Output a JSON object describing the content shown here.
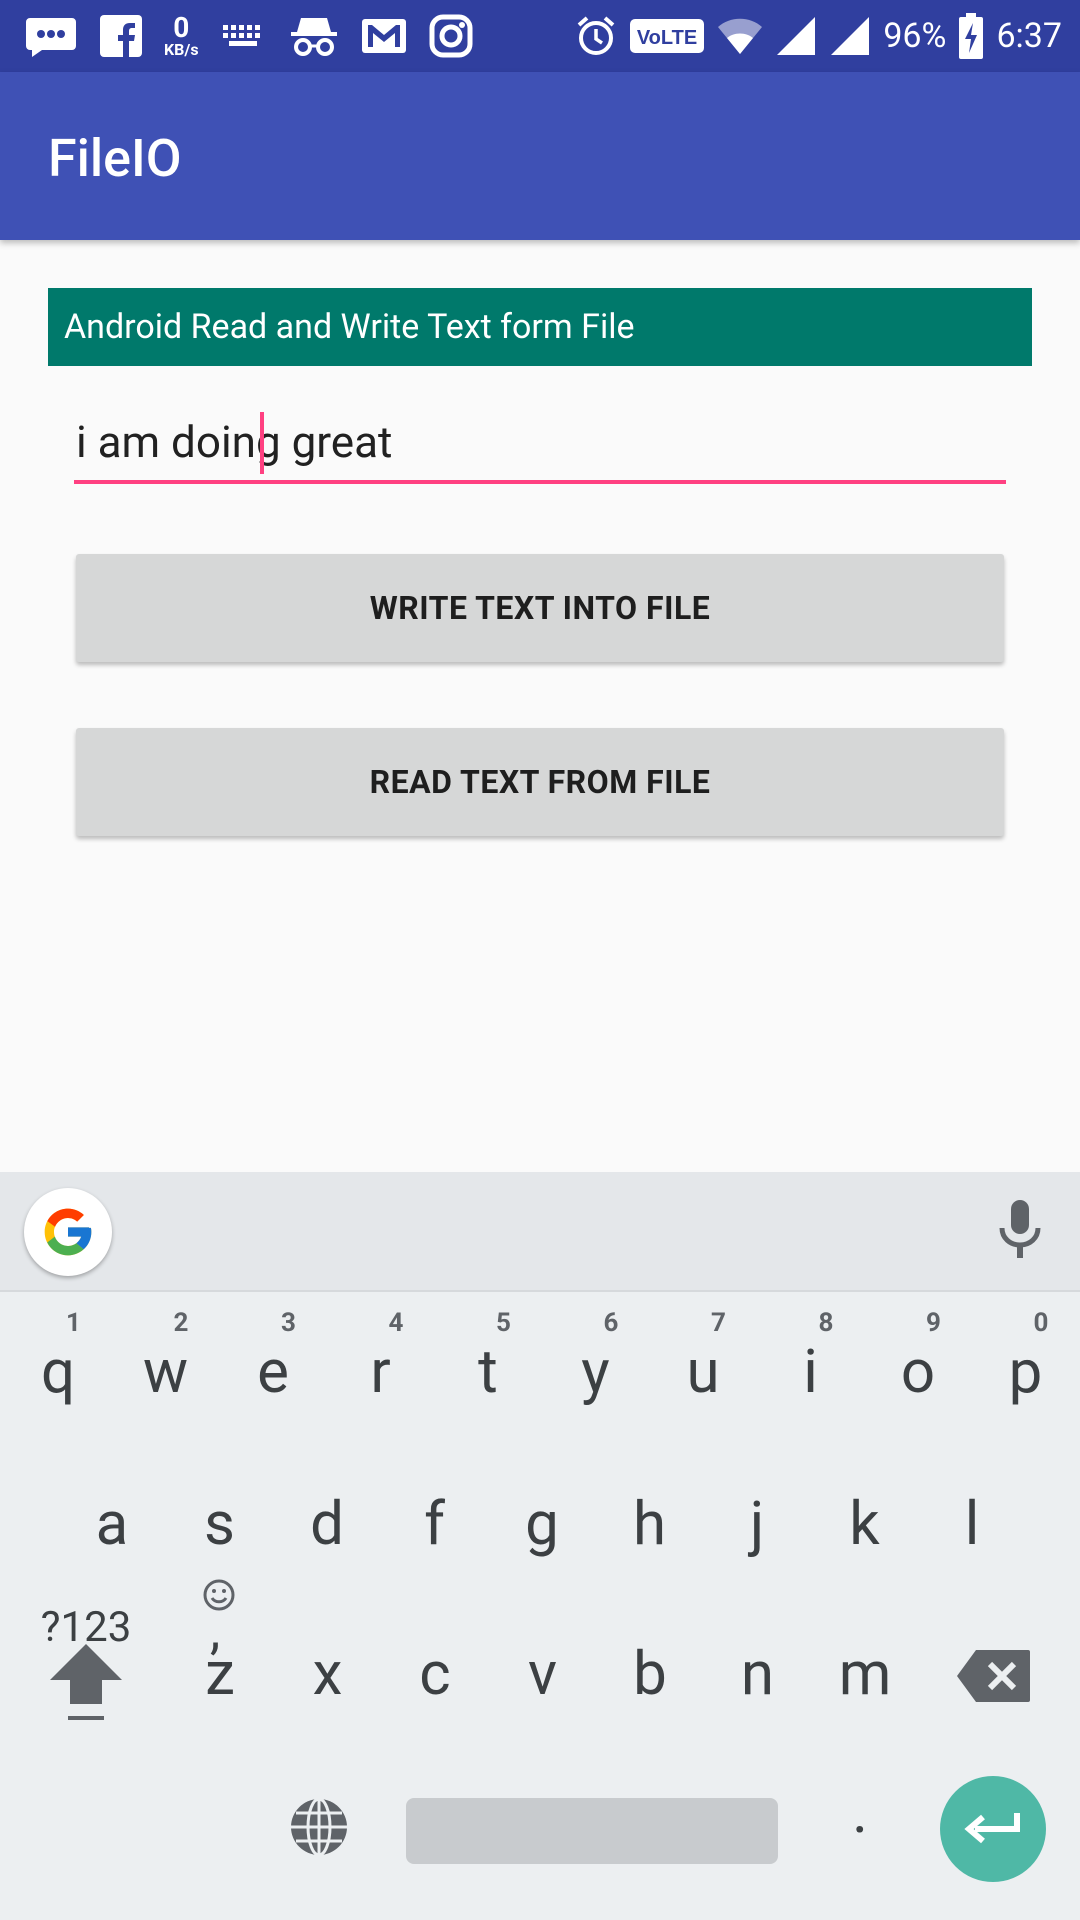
{
  "status_bar": {
    "net_speed_value": "0",
    "net_speed_unit": "KB/s",
    "volte_label": "VoLTE",
    "battery": "96%",
    "time": "6:37",
    "icons": [
      "messages-icon",
      "facebook-icon",
      "keyboard-icon",
      "incognito-icon",
      "gmail-icon",
      "instagram-icon",
      "alarm-icon",
      "wifi-icon",
      "signal-icon",
      "signal-icon",
      "battery-charging-icon"
    ]
  },
  "app_bar": {
    "title": "FileIO"
  },
  "content": {
    "banner_text": "Android Read and Write Text form File",
    "edit_text_value": "i am doing great",
    "write_button_label": "WRITE TEXT INTO FILE",
    "read_button_label": "READ TEXT FROM FILE"
  },
  "keyboard": {
    "rows": [
      [
        {
          "key": "q",
          "hint": "1"
        },
        {
          "key": "w",
          "hint": "2"
        },
        {
          "key": "e",
          "hint": "3"
        },
        {
          "key": "r",
          "hint": "4"
        },
        {
          "key": "t",
          "hint": "5"
        },
        {
          "key": "y",
          "hint": "6"
        },
        {
          "key": "u",
          "hint": "7"
        },
        {
          "key": "i",
          "hint": "8"
        },
        {
          "key": "o",
          "hint": "9"
        },
        {
          "key": "p",
          "hint": "0"
        }
      ],
      [
        {
          "key": "a"
        },
        {
          "key": "s"
        },
        {
          "key": "d"
        },
        {
          "key": "f"
        },
        {
          "key": "g"
        },
        {
          "key": "h"
        },
        {
          "key": "j"
        },
        {
          "key": "k"
        },
        {
          "key": "l"
        }
      ],
      [
        {
          "key": "z"
        },
        {
          "key": "x"
        },
        {
          "key": "c"
        },
        {
          "key": "v"
        },
        {
          "key": "b"
        },
        {
          "key": "n"
        },
        {
          "key": "m"
        }
      ]
    ],
    "symbols_label": "?123",
    "comma_label": ",",
    "period_label": ".",
    "colors": {
      "enter": "#4fb8a6",
      "accent": "#ff4081",
      "appbar": "#3f51b5",
      "statusbar": "#303f9f",
      "banner": "#00796b"
    }
  }
}
